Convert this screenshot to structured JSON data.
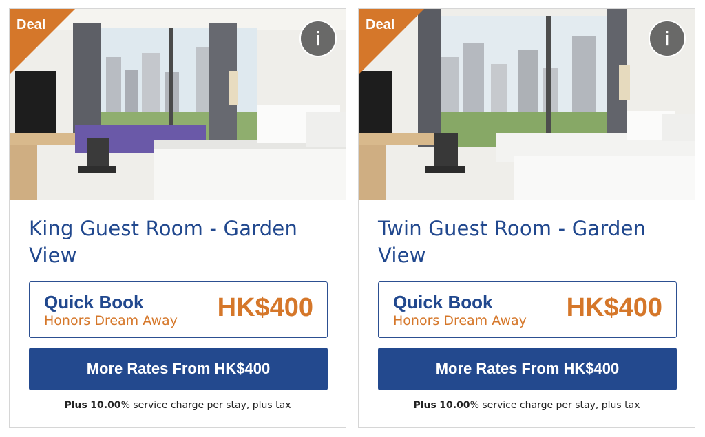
{
  "rooms": [
    {
      "deal_badge": "Deal",
      "info_icon": "i",
      "title": "King Guest Room - Garden View",
      "quick_book": {
        "title": "Quick Book",
        "subtitle": "Honors Dream Away",
        "price": "HK$400"
      },
      "more_rates_label": "More Rates From HK$400",
      "service": {
        "prefix": "Plus",
        "rate": "10.00",
        "suffix": "% service charge per stay, plus tax"
      }
    },
    {
      "deal_badge": "Deal",
      "info_icon": "i",
      "title": "Twin Guest Room - Garden View",
      "quick_book": {
        "title": "Quick Book",
        "subtitle": "Honors Dream Away",
        "price": "HK$400"
      },
      "more_rates_label": "More Rates From HK$400",
      "service": {
        "prefix": "Plus",
        "rate": "10.00",
        "suffix": "% service charge per stay, plus tax"
      }
    }
  ],
  "colors": {
    "brand_blue": "#23498e",
    "accent_orange": "#d5772a"
  }
}
